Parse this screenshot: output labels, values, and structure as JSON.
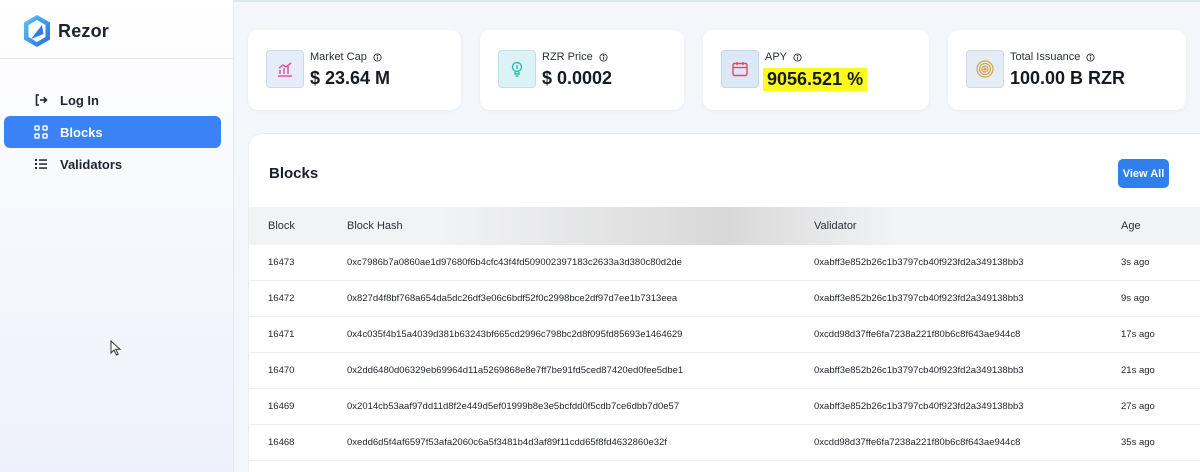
{
  "app": {
    "name": "Rezor"
  },
  "sidebar": {
    "items": [
      {
        "label": "Log In",
        "icon": "login-icon",
        "active": false
      },
      {
        "label": "Blocks",
        "icon": "blocks-icon",
        "active": true
      },
      {
        "label": "Validators",
        "icon": "list-icon",
        "active": false
      }
    ]
  },
  "stats": {
    "market_cap": {
      "label": "Market Cap",
      "value": "$ 23.64 M"
    },
    "price": {
      "label": "RZR Price",
      "value": "$ 0.0002"
    },
    "apy": {
      "label": "APY",
      "value": "9056.521 %",
      "highlight": "#fbfa1c"
    },
    "issuance": {
      "label": "Total Issuance",
      "value": "100.00 B RZR"
    }
  },
  "blocks": {
    "title": "Blocks",
    "view_all_label": "View All",
    "columns": {
      "block": "Block",
      "hash": "Block Hash",
      "validator": "Validator",
      "age": "Age"
    },
    "rows": [
      {
        "block": "16473",
        "hash": "0xc7986b7a0860ae1d97680f6b4cfc43f4fd509002397183c2633a3d380c80d2de",
        "validator": "0xabff3e852b26c1b3797cb40f923fd2a349138bb3",
        "age": "3s ago"
      },
      {
        "block": "16472",
        "hash": "0x827d4f8bf768a654da5dc26df3e06c6bdf52f0c2998bce2df97d7ee1b7313eea",
        "validator": "0xabff3e852b26c1b3797cb40f923fd2a349138bb3",
        "age": "9s ago"
      },
      {
        "block": "16471",
        "hash": "0x4c035f4b15a4039d381b63243bf665cd2996c798bc2d8f095fd85693e1464629",
        "validator": "0xcdd98d37ffe6fa7238a221f80b6c8f643ae944c8",
        "age": "17s ago"
      },
      {
        "block": "16470",
        "hash": "0x2dd6480d06329eb69964d11a5269868e8e7ff7be91fd5ced87420ed0fee5dbe1",
        "validator": "0xabff3e852b26c1b3797cb40f923fd2a349138bb3",
        "age": "21s ago"
      },
      {
        "block": "16469",
        "hash": "0x2014cb53aaf97dd11d8f2e449d5ef01999b8e3e5bcfdd0f5cdb7ce6dbb7d0e57",
        "validator": "0xabff3e852b26c1b3797cb40f923fd2a349138bb3",
        "age": "27s ago"
      },
      {
        "block": "16468",
        "hash": "0xedd6d5f4af6597f53afa2060c6a5f3481b4d3af89f11cdd65f8fd4632860e32f",
        "validator": "0xcdd98d37ffe6fa7238a221f80b6c8f643ae944c8",
        "age": "35s ago"
      }
    ]
  },
  "colors": {
    "accent": "#3b82f6",
    "button": "#2f80ed"
  }
}
